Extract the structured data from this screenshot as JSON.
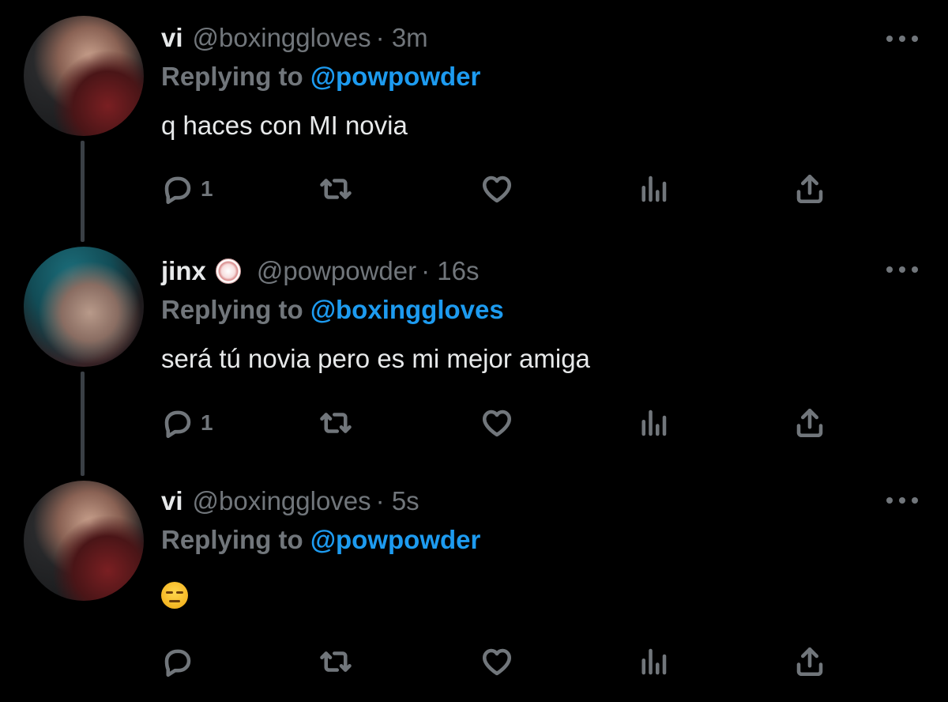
{
  "tweets": [
    {
      "display_name": "vi",
      "handle": "@boxinggloves",
      "time": "· 3m",
      "replying_prefix": "Replying to",
      "replying_to": "@powpowder",
      "text": "q haces con MI novia",
      "reply_count": "1"
    },
    {
      "display_name": "jinx",
      "handle": "@powpowder",
      "time": "· 16s",
      "replying_prefix": "Replying to",
      "replying_to": "@boxinggloves",
      "text": "será tú novia pero es mi mejor amiga",
      "reply_count": "1"
    },
    {
      "display_name": "vi",
      "handle": "@boxinggloves",
      "time": "· 5s",
      "replying_prefix": "Replying to",
      "replying_to": "@powpowder",
      "emoji": "unamused-face",
      "reply_count": ""
    }
  ],
  "colors": {
    "background": "#000000",
    "text": "#e7e9ea",
    "muted": "#71767b",
    "mention": "#1d9bf0",
    "thread_line": "#3a3f45"
  },
  "icons": [
    "reply-icon",
    "retweet-icon",
    "like-icon",
    "analytics-icon",
    "share-icon",
    "more-icon"
  ]
}
